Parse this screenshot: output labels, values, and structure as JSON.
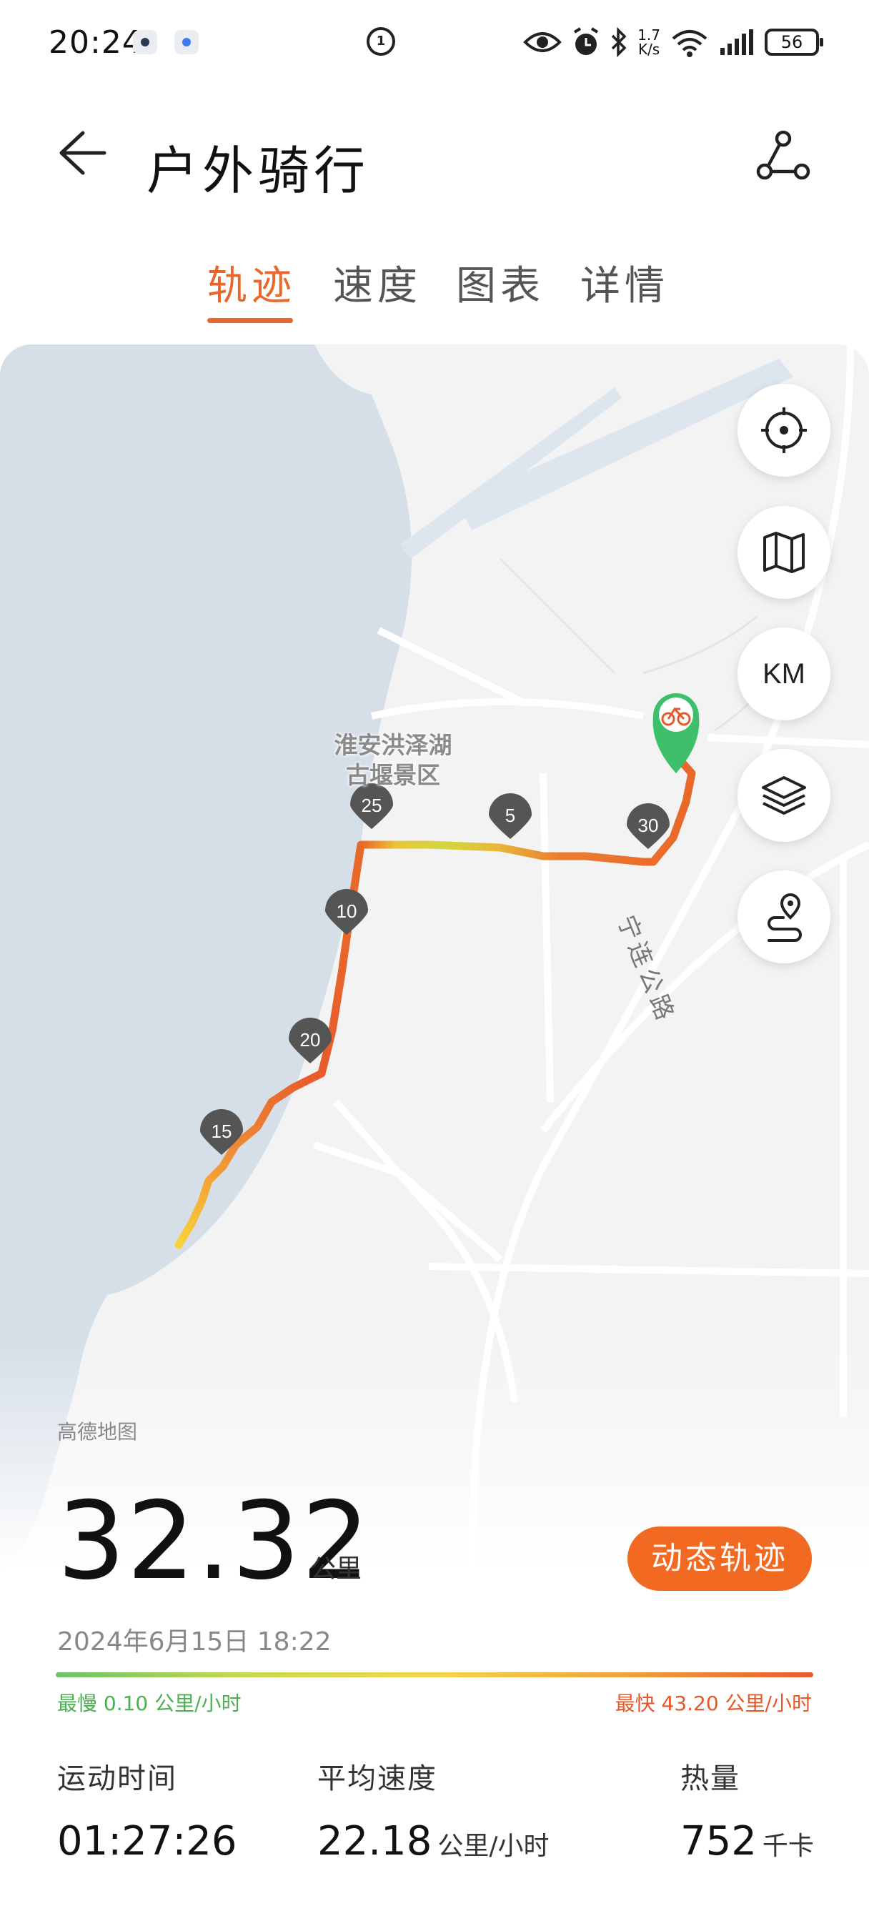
{
  "status_bar": {
    "time": "20:24",
    "net_speed_value": "1.7",
    "net_speed_unit": "K/s",
    "battery": "56"
  },
  "header": {
    "title": "户外骑行"
  },
  "tabs": [
    {
      "label": "轨迹",
      "active": true
    },
    {
      "label": "速度",
      "active": false
    },
    {
      "label": "图表",
      "active": false
    },
    {
      "label": "详情",
      "active": false
    }
  ],
  "map": {
    "place_label_line1": "淮安洪泽湖",
    "place_label_line2": "古堰景区",
    "road_label": "宁连公路",
    "source": "高德地图",
    "unit_button": "KM",
    "markers": [
      "25",
      "5",
      "30",
      "10",
      "20",
      "15"
    ]
  },
  "summary": {
    "distance": "32.32",
    "distance_unit": "公里",
    "datetime": "2024年6月15日 18:22",
    "replay_button": "动态轨迹",
    "slowest": "最慢 0.10 公里/小时",
    "fastest": "最快 43.20 公里/小时"
  },
  "stats": [
    {
      "label": "运动时间",
      "value": "01:27:26",
      "unit": ""
    },
    {
      "label": "平均速度",
      "value": "22.18",
      "unit": "公里/小时"
    },
    {
      "label": "热量",
      "value": "752",
      "unit": "千卡"
    }
  ],
  "colors": {
    "accent": "#e8672a",
    "button": "#f26a22",
    "slow": "#4caf50",
    "fast": "#e8572a",
    "water": "#d6dfe8",
    "map_bg": "#f3f3f4"
  }
}
